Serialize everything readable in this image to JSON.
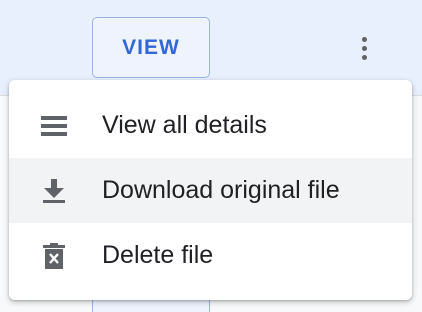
{
  "table_row": {
    "view_button_label": "VIEW"
  },
  "menu": {
    "items": [
      {
        "label": "View all details",
        "icon": "list-icon",
        "hovered": false
      },
      {
        "label": "Download original file",
        "icon": "download-icon",
        "hovered": true
      },
      {
        "label": "Delete file",
        "icon": "delete-icon",
        "hovered": false
      }
    ]
  },
  "colors": {
    "accent": "#3367d6",
    "icon": "#5f6368",
    "text": "#202124",
    "hover": "#f1f3f4"
  }
}
